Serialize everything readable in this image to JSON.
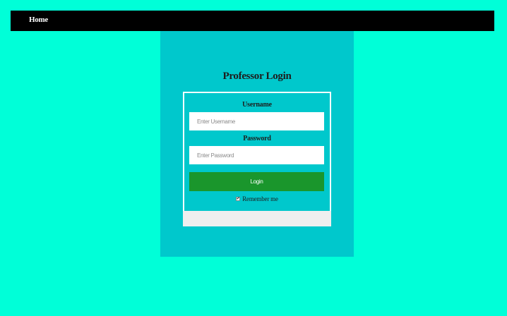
{
  "nav": {
    "home_label": "Home"
  },
  "login": {
    "title": "Professor Login",
    "username_label": "Username",
    "username_placeholder": "Enter Username",
    "username_value": "",
    "password_label": "Password",
    "password_placeholder": "Enter Password",
    "password_value": "",
    "submit_label": "Login",
    "remember_label": "Remember me",
    "remember_checked": true,
    "remember_check_glyph": "✔"
  },
  "colors": {
    "page_background": "#00ffd8",
    "navbar_background": "#000000",
    "panel_background": "#00c8cc",
    "login_button": "#1a962c",
    "footer_box": "#efefef"
  }
}
